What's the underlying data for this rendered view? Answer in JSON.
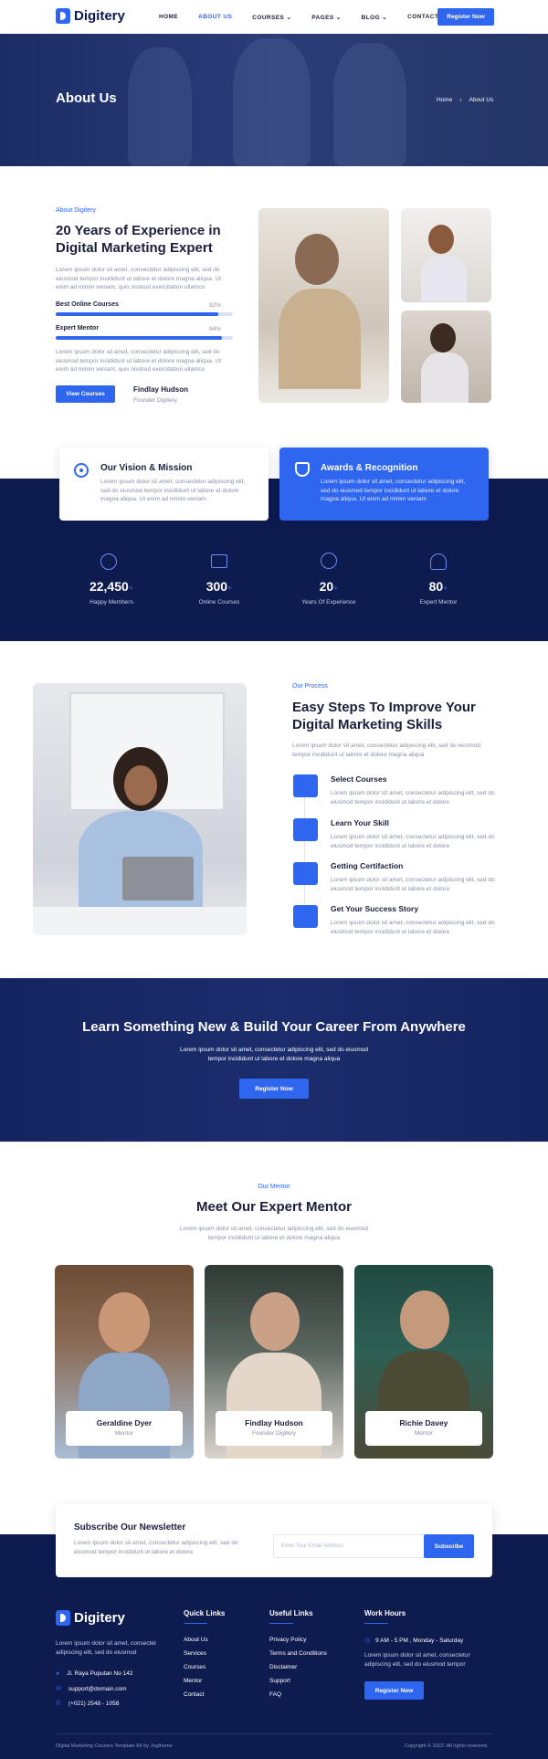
{
  "brand": {
    "name": "Digitery",
    "accent": "#2f66f0",
    "dark": "#0e1b4f"
  },
  "nav": {
    "items": [
      {
        "label": "HOME"
      },
      {
        "label": "ABOUT US"
      },
      {
        "label": "COURSES"
      },
      {
        "label": "PAGES"
      },
      {
        "label": "BLOG"
      },
      {
        "label": "CONTACT"
      }
    ],
    "cta": "Register Now"
  },
  "hero": {
    "title": "About Us",
    "breadcrumb": {
      "home": "Home",
      "current": "About Us"
    }
  },
  "about": {
    "eyebrow": "About Digitery",
    "heading": "20 Years of Experience in Digital Marketing Expert",
    "text1": "Lorem ipsum dolor sit amet, consectetur adipiscing elit, sed do eiusmod tempor incididunt ut labore et dolore magna aliqua. Ut enim ad minim veniam, quis nostrud exercitation ullamco",
    "skills": [
      {
        "label": "Best Online Courses",
        "value_text": "92%",
        "value": 0.92
      },
      {
        "label": "Expert Mentor",
        "value_text": "94%",
        "value": 0.94
      }
    ],
    "text2": "Lorem ipsum dolor sit amet, consectetur adipiscing elit, sed do eiusmod tempor incididunt ut labore et dolore magna aliqua. Ut enim ad minim veniam, quis nostrud exercitation ullamco",
    "button": "View Courses",
    "founder_name": "Findlay Hudson",
    "founder_role": "Founder Digitery"
  },
  "features": [
    {
      "title": "Our Vision & Mission",
      "text": "Lorem ipsum dolor sit amet, consectetur adipiscing elit, sed do eiusmod tempor incididunt ut labore et dolore magna aliqua. Ut enim ad minim veniam",
      "icon": "target-icon"
    },
    {
      "title": "Awards & Recognition",
      "text": "Lorem ipsum dolor sit amet, consectetur adipiscing elit, sed do eiusmod tempor incididunt ut labore et dolore magna aliqua. Ut enim ad minim veniam",
      "icon": "trophy-icon"
    }
  ],
  "stats": [
    {
      "number": "22,450",
      "plus": "+",
      "label": "Happy Members",
      "icon": "globe-icon"
    },
    {
      "number": "300",
      "plus": "+",
      "label": "Online Courses",
      "icon": "book-icon"
    },
    {
      "number": "20",
      "plus": "+",
      "label": "Years Of Experience",
      "icon": "badge-icon"
    },
    {
      "number": "80",
      "plus": "+",
      "label": "Expert Mentor",
      "icon": "users-icon"
    }
  ],
  "process": {
    "eyebrow": "Our Process",
    "heading": "Easy Steps To Improve Your Digital Marketing Skills",
    "text": "Lorem ipsum dolor sit amet, consectetur adipiscing elit, sed do eiusmod tempor incididunt ut labore et dolore magna aliqua",
    "steps": [
      {
        "title": "Select Courses",
        "text": "Lorem ipsum dolor sit amet, consectetur adipiscing elit, sed do eiusmod tempor incididunt ut labore et dolore"
      },
      {
        "title": "Learn Your Skill",
        "text": "Lorem ipsum dolor sit amet, consectetur adipiscing elit, sed do eiusmod tempor incididunt ut labore et dolore"
      },
      {
        "title": "Getting Certifaction",
        "text": "Lorem ipsum dolor sit amet, consectetur adipiscing elit, sed do eiusmod tempor incididunt ut labore et dolore"
      },
      {
        "title": "Get Your Success Story",
        "text": "Lorem ipsum dolor sit amet, consectetur adipiscing elit, sed do eiusmod tempor incididunt ut labore et dolore"
      }
    ]
  },
  "cta": {
    "heading": "Learn Something New & Build Your Career From Anywhere",
    "text": "Lorem ipsum dolor sit amet, consectetur adipiscing elit, sed do eiusmod tempor incididunt ut labore et dolore magna aliqua",
    "button": "Register Now"
  },
  "mentors": {
    "eyebrow": "Our Mentor",
    "heading": "Meet Our Expert Mentor",
    "text": "Lorem ipsum dolor sit amet, consectetur adipiscing elit, sed do eiusmod tempor incididunt ut labore et dolore magna aliqua",
    "items": [
      {
        "name": "Geraldine Dyer",
        "role": "Mentor"
      },
      {
        "name": "Findlay Hudson",
        "role": "Founder Digitery"
      },
      {
        "name": "Richie Davey",
        "role": "Mentor"
      }
    ]
  },
  "newsletter": {
    "title": "Subscribe Our Newsletter",
    "text": "Lorem ipsum dolor sit amet, consectetur adipiscing elit, sed do eiusmod tempor incididunt ut labore et dolore",
    "placeholder": "Enter Your Email Address",
    "button": "Subscribe"
  },
  "footer": {
    "about": "Lorem ipsum dolor sit amet, consectet adipiscing elit, sed do eiusmod",
    "address": "Jl. Raya Puputan No 142",
    "email": "support@domain.com",
    "phone": "(+021) 2548 - 1058",
    "quick_title": "Quick Links",
    "quick": [
      "About Us",
      "Services",
      "Courses",
      "Mentor",
      "Contact"
    ],
    "useful_title": "Useful Links",
    "useful": [
      "Privacy Policy",
      "Terms and Conditions",
      "Disclaimer",
      "Support",
      "FAQ"
    ],
    "hours_title": "Work Hours",
    "hours": "9 AM - 5 PM , Monday - Saturday",
    "hours_text": "Lorem ipsum dolor sit amet, consectetur adipiscing elit, sed do eiusmod tempor",
    "button": "Register Now",
    "credit": "Digital Marketing Courses Template Kit by Jegtheme",
    "copyright": "Copyright © 2022. All rights reserved."
  }
}
